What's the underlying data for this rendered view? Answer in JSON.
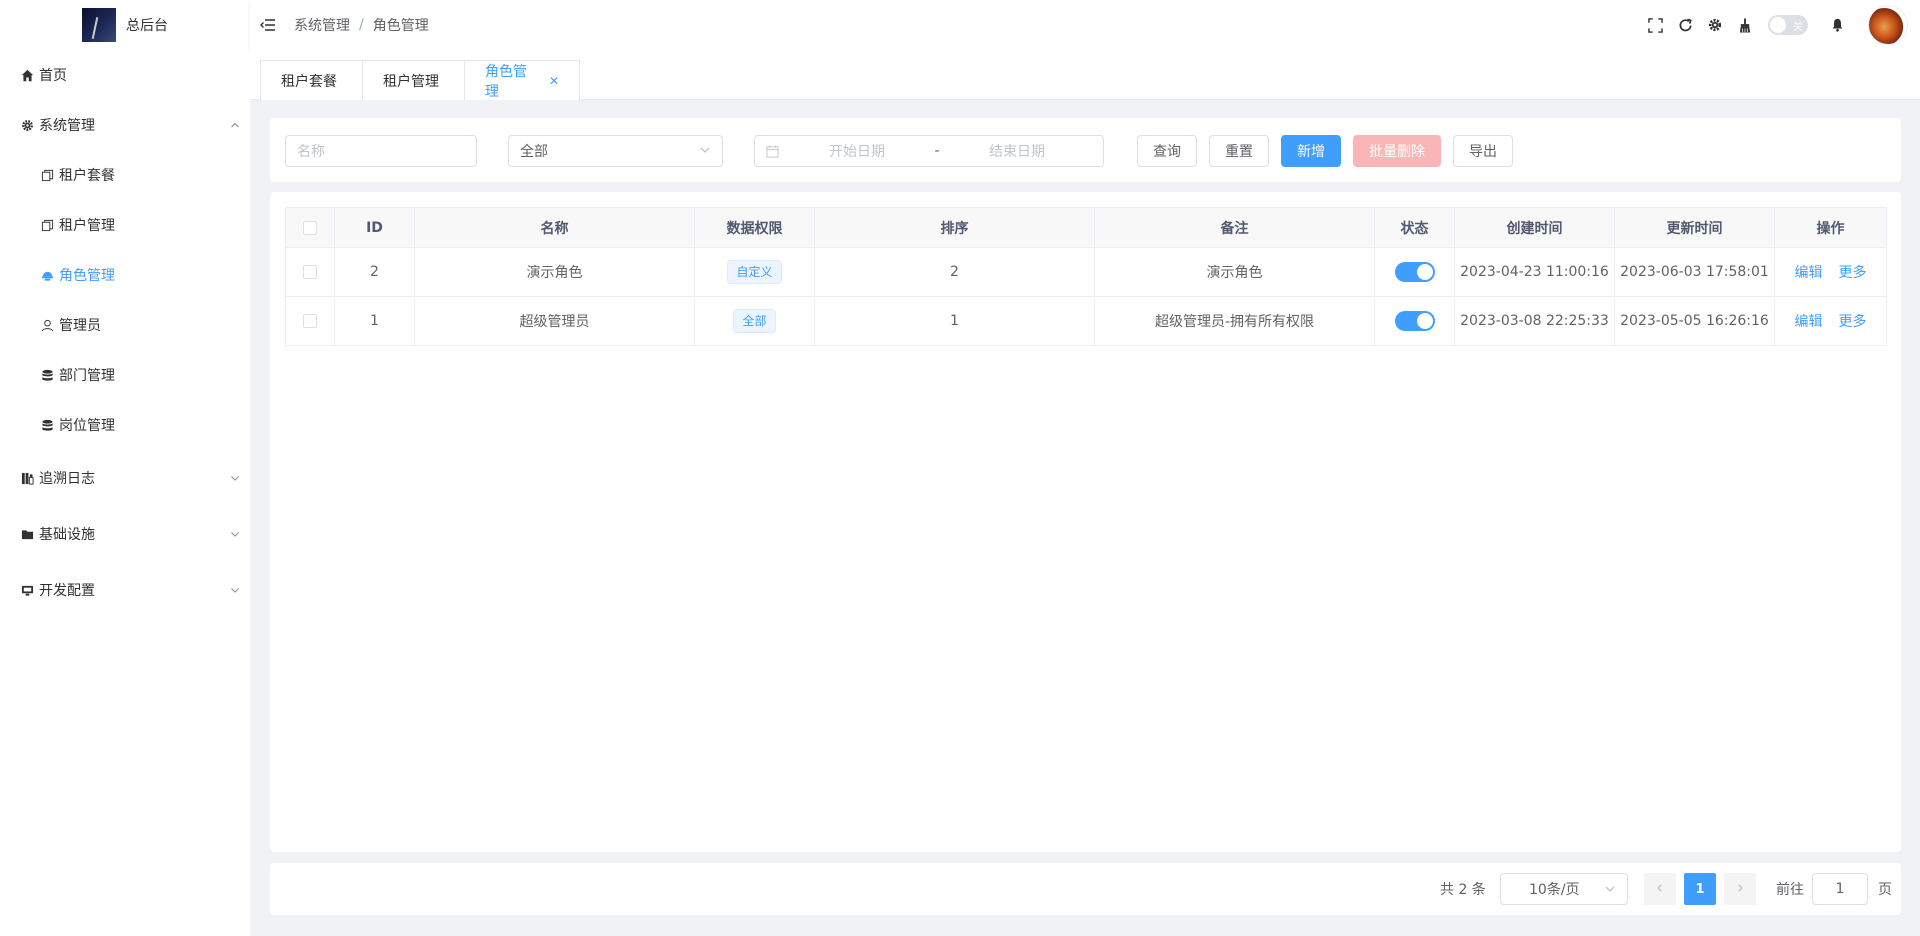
{
  "app": {
    "title": "总后台"
  },
  "sidebar": {
    "items": [
      {
        "label": "首页",
        "icon": "home-icon"
      },
      {
        "label": "系统管理",
        "icon": "gear-icon",
        "expanded": true,
        "children": [
          {
            "label": "租户套餐",
            "icon": "copy-icon"
          },
          {
            "label": "租户管理",
            "icon": "copy-icon"
          },
          {
            "label": "角色管理",
            "icon": "role-icon",
            "active": true
          },
          {
            "label": "管理员",
            "icon": "user-icon"
          },
          {
            "label": "部门管理",
            "icon": "database-icon"
          },
          {
            "label": "岗位管理",
            "icon": "database-icon"
          }
        ]
      },
      {
        "label": "追溯日志",
        "icon": "log-icon",
        "expanded": false
      },
      {
        "label": "基础设施",
        "icon": "folder-icon",
        "expanded": false
      },
      {
        "label": "开发配置",
        "icon": "monitor-icon",
        "expanded": false
      }
    ]
  },
  "header": {
    "breadcrumb": [
      "系统管理",
      "角色管理"
    ],
    "theme_switch_label": "关"
  },
  "tags": [
    {
      "label": "租户套餐",
      "active": false
    },
    {
      "label": "租户管理",
      "active": false
    },
    {
      "label": "角色管理",
      "active": true
    }
  ],
  "search": {
    "name_placeholder": "名称",
    "status_value": "全部",
    "start_date_placeholder": "开始日期",
    "date_separator": "-",
    "end_date_placeholder": "结束日期",
    "query_label": "查询",
    "reset_label": "重置",
    "add_label": "新增",
    "batch_delete_label": "批量删除",
    "export_label": "导出"
  },
  "table": {
    "columns": [
      "ID",
      "名称",
      "数据权限",
      "排序",
      "备注",
      "状态",
      "创建时间",
      "更新时间",
      "操作"
    ],
    "rows": [
      {
        "id": "2",
        "name": "演示角色",
        "data_scope": "自定义",
        "sort": "2",
        "remark": "演示角色",
        "status": true,
        "created": "2023-04-23 11:00:16",
        "updated": "2023-06-03 17:58:01",
        "edit": "编辑",
        "more": "更多"
      },
      {
        "id": "1",
        "name": "超级管理员",
        "data_scope": "全部",
        "sort": "1",
        "remark": "超级管理员-拥有所有权限",
        "status": true,
        "created": "2023-03-08 22:25:33",
        "updated": "2023-05-05 16:26:16",
        "edit": "编辑",
        "more": "更多"
      }
    ]
  },
  "pagination": {
    "total_text": "共 2 条",
    "page_size": "10条/页",
    "current_page": "1",
    "goto_prefix": "前往",
    "goto_value": "1",
    "goto_suffix": "页"
  },
  "colors": {
    "primary": "#409eff",
    "danger_disabled": "#fab6b6",
    "text": "#303133"
  }
}
